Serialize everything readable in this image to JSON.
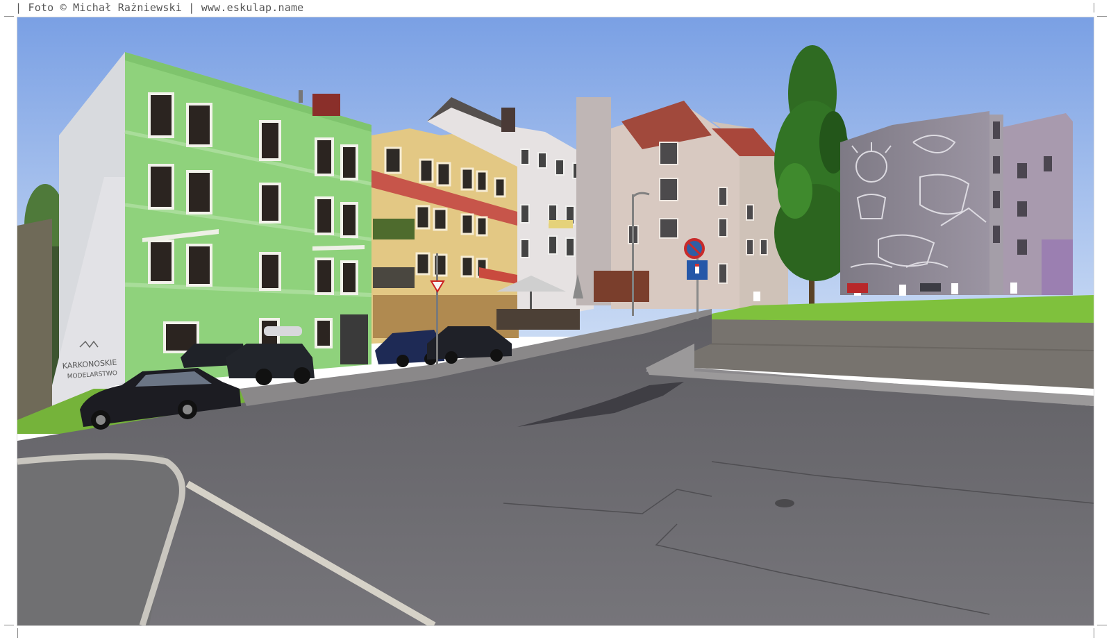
{
  "credit": {
    "prefix": "Foto © Michał Rażniewski",
    "separator": "|",
    "site": "www.eskulap.name"
  },
  "photo": {
    "subject": "street corner with colorful tenement houses, parked cars, a tree and a mural on a grey wall",
    "colors": {
      "sky": "#8fb2ea",
      "green_building": "#8cd17a",
      "yellow_building": "#e2c781",
      "white_building": "#e6e1df",
      "asphalt": "#6e6c70",
      "grass": "#7fbf3a",
      "tree": "#2e6f24",
      "mural_wall": "#8b8791"
    },
    "text": {
      "graffiti_line1": "KARKONOSKIE",
      "graffiti_line2": "MODELARSTWO"
    }
  }
}
